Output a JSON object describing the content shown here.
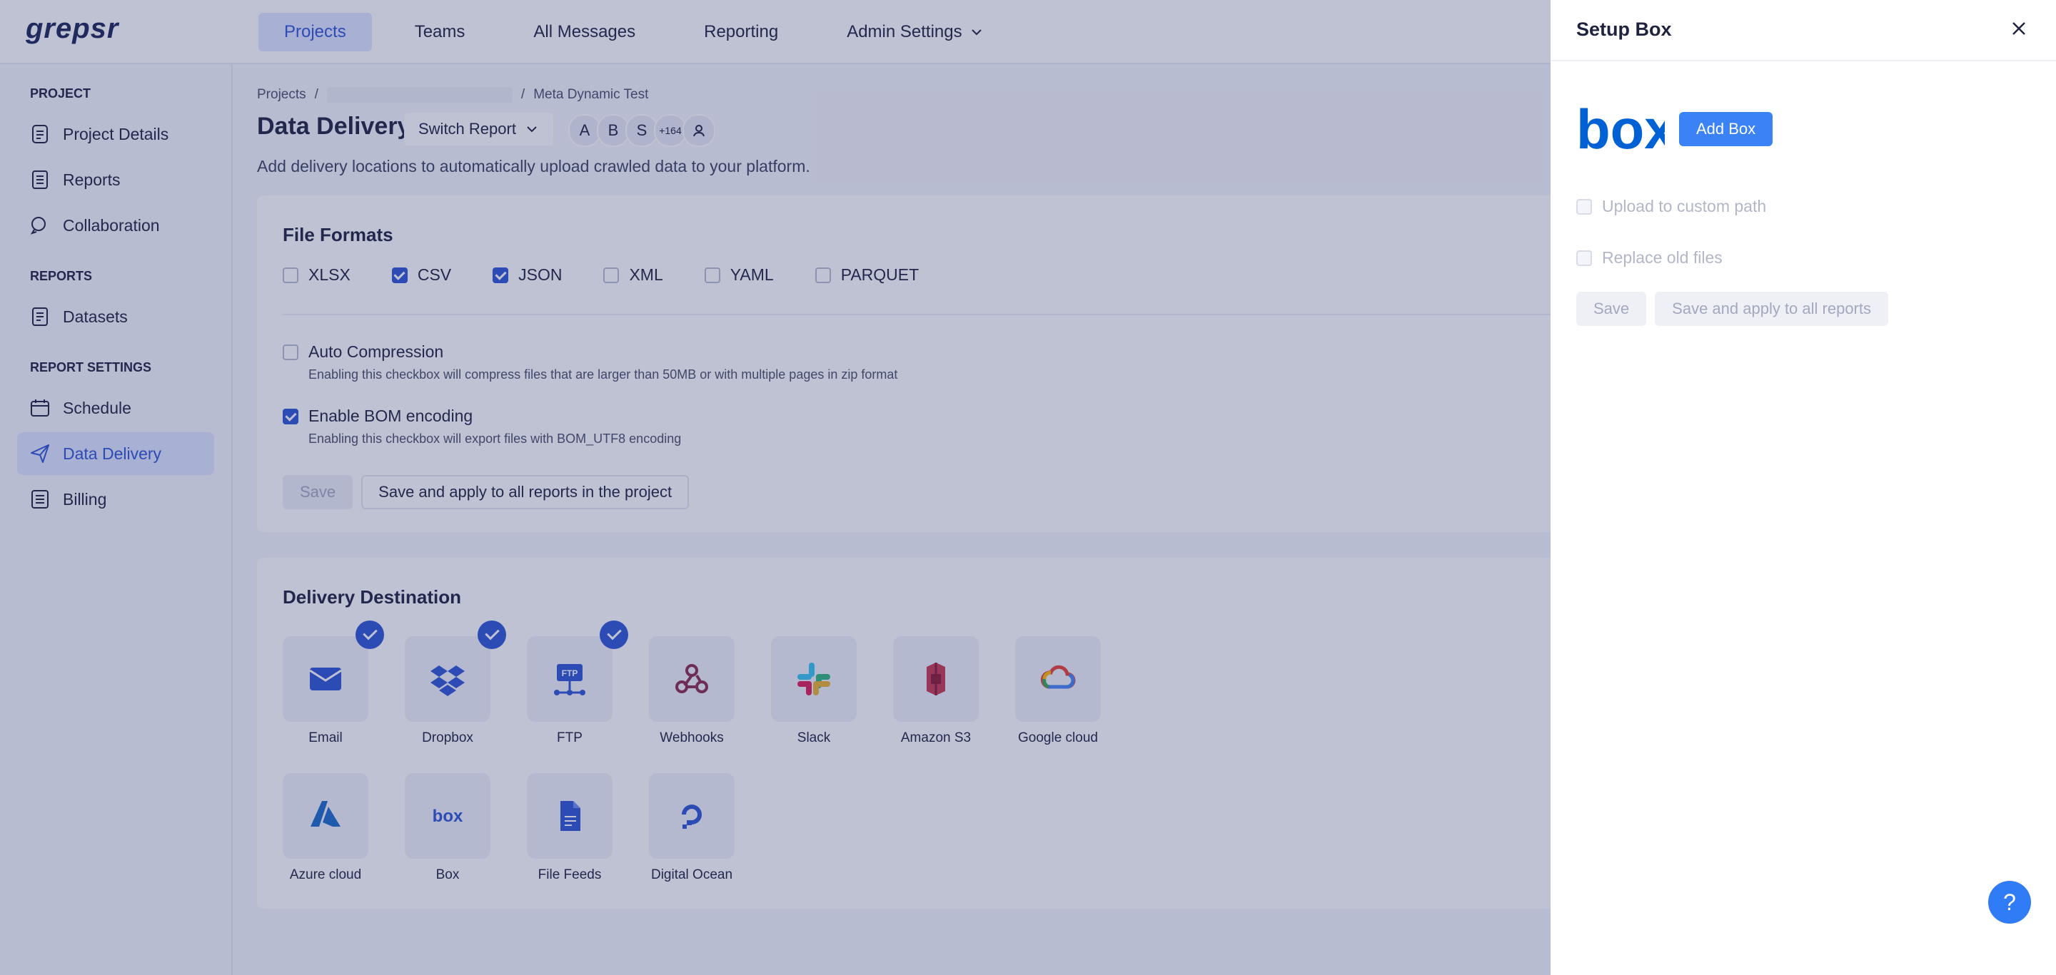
{
  "app": {
    "logo": "grepsr"
  },
  "topnav": {
    "items": [
      "Projects",
      "Teams",
      "All Messages",
      "Reporting",
      "Admin Settings"
    ],
    "active": "Projects"
  },
  "sidebar": {
    "project_section": "PROJECT",
    "project_items": [
      "Project Details",
      "Reports",
      "Collaboration"
    ],
    "reports_section": "REPORTS",
    "reports_items": [
      "Datasets"
    ],
    "settings_section": "REPORT SETTINGS",
    "settings_items": [
      "Schedule",
      "Data Delivery",
      "Billing"
    ],
    "active": "Data Delivery"
  },
  "breadcrumb": {
    "root": "Projects",
    "sep1": "/",
    "sep2": "/",
    "current": "Meta Dynamic Test"
  },
  "page": {
    "title": "Data Delivery",
    "switch_report": "Switch Report",
    "subtitle": "Add delivery locations to automatically upload crawled data to your platform.",
    "avatars": [
      "A",
      "B",
      "S",
      "+164"
    ]
  },
  "file_formats": {
    "title": "File Formats",
    "formats": [
      {
        "label": "XLSX",
        "checked": false
      },
      {
        "label": "CSV",
        "checked": true
      },
      {
        "label": "JSON",
        "checked": true
      },
      {
        "label": "XML",
        "checked": false
      },
      {
        "label": "YAML",
        "checked": false
      },
      {
        "label": "PARQUET",
        "checked": false
      }
    ],
    "auto_compression": {
      "label": "Auto Compression",
      "help": "Enabling this checkbox will compress files that are larger than 50MB or with multiple pages in zip format",
      "checked": false
    },
    "bom_encoding": {
      "label": "Enable BOM encoding",
      "help": "Enabling this checkbox will export files with BOM_UTF8 encoding",
      "checked": true
    },
    "save_label": "Save",
    "save_all_label": "Save and apply to all reports in the project"
  },
  "delivery": {
    "title": "Delivery Destination",
    "destinations": [
      {
        "label": "Email",
        "icon": "email-icon",
        "checked": true
      },
      {
        "label": "Dropbox",
        "icon": "dropbox-icon",
        "checked": true
      },
      {
        "label": "FTP",
        "icon": "ftp-icon",
        "checked": true
      },
      {
        "label": "Webhooks",
        "icon": "webhooks-icon",
        "checked": false
      },
      {
        "label": "Slack",
        "icon": "slack-icon",
        "checked": false
      },
      {
        "label": "Amazon S3",
        "icon": "amazon-s3-icon",
        "checked": false
      },
      {
        "label": "Google cloud",
        "icon": "google-cloud-icon",
        "checked": false
      },
      {
        "label": "Azure cloud",
        "icon": "azure-icon",
        "checked": false
      },
      {
        "label": "Box",
        "icon": "box-icon",
        "checked": false
      },
      {
        "label": "File Feeds",
        "icon": "file-feeds-icon",
        "checked": false
      },
      {
        "label": "Digital Ocean",
        "icon": "digital-ocean-icon",
        "checked": false
      }
    ]
  },
  "drawer": {
    "title": "Setup Box",
    "logo_text": "box",
    "add_button": "Add Box",
    "upload_custom_path": "Upload to custom path",
    "replace_old_files": "Replace old files",
    "save_label": "Save",
    "save_all_label": "Save and apply to all reports"
  },
  "help": {
    "label": "?"
  },
  "colors": {
    "primary": "#2f55d4",
    "box_blue": "#0061d5",
    "add_button": "#3b82f6",
    "overlay": "#2c346e"
  }
}
